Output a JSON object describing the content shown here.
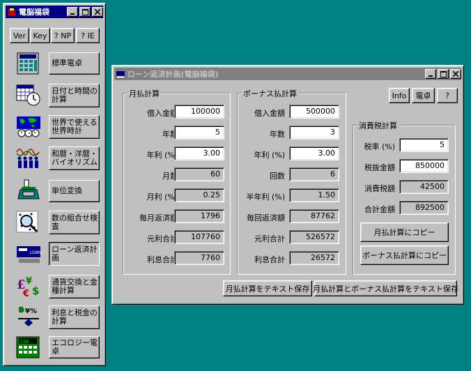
{
  "launcher": {
    "title": "電脳福袋",
    "top_buttons": [
      "Ver",
      "Key",
      "? NP",
      "? IE"
    ],
    "items": [
      {
        "label": "標準電卓",
        "icon": "calculator-icon"
      },
      {
        "label": "日付と時間の計算",
        "icon": "calendar-clock-icon"
      },
      {
        "label": "世界で使える世界時計",
        "icon": "world-clock-icon"
      },
      {
        "label": "和暦・洋暦・バイオリズム",
        "icon": "biorhythm-icon"
      },
      {
        "label": "単位変換",
        "icon": "scale-icon"
      },
      {
        "label": "数の組合せ検査",
        "icon": "magnifier-icon"
      },
      {
        "label": "ローン返済計画",
        "icon": "loan-icon"
      },
      {
        "label": "通貨交換と金種計算",
        "icon": "currency-icon"
      },
      {
        "label": "利息と税金の計算",
        "icon": "interest-tax-icon"
      },
      {
        "label": "エコロジー電卓",
        "icon": "eco-calculator-icon"
      }
    ]
  },
  "loan": {
    "title": "ローン返済計画(電脳福袋)",
    "buttons": {
      "info": "Info",
      "calc": "電卓",
      "help": "?"
    },
    "monthly": {
      "title": "月払計算",
      "rows": [
        {
          "label": "借入金額",
          "value": "100000",
          "editable": true
        },
        {
          "label": "年数",
          "value": "5",
          "editable": true
        },
        {
          "label": "年利 (%)",
          "value": "3.00",
          "editable": true
        },
        {
          "label": "月数",
          "value": "60",
          "editable": false
        },
        {
          "label": "月利 (%)",
          "value": "0.25",
          "editable": false
        },
        {
          "label": "毎月返済額",
          "value": "1796",
          "editable": false
        },
        {
          "label": "元利合計",
          "value": "107760",
          "editable": false
        },
        {
          "label": "利息合計",
          "value": "7760",
          "editable": false
        }
      ]
    },
    "bonus": {
      "title": "ボーナス払計算",
      "rows": [
        {
          "label": "借入金額",
          "value": "500000",
          "editable": true
        },
        {
          "label": "年数",
          "value": "3",
          "editable": true
        },
        {
          "label": "年利 (%)",
          "value": "3.00",
          "editable": true
        },
        {
          "label": "回数",
          "value": "6",
          "editable": false
        },
        {
          "label": "半年利 (%)",
          "value": "1.50",
          "editable": false
        },
        {
          "label": "毎回返済額",
          "value": "87762",
          "editable": false
        },
        {
          "label": "元利合計",
          "value": "526572",
          "editable": false
        },
        {
          "label": "利息合計",
          "value": "26572",
          "editable": false
        }
      ]
    },
    "tax": {
      "title": "消費税計算",
      "rows": [
        {
          "label": "税率 (%)",
          "value": "5",
          "editable": true
        },
        {
          "label": "税抜金額",
          "value": "850000",
          "editable": true
        },
        {
          "label": "消費税額",
          "value": "42500",
          "editable": false
        },
        {
          "label": "合計金額",
          "value": "892500",
          "editable": false
        }
      ],
      "copy_monthly": "月払計算にコピー",
      "copy_bonus": "ボーナス払計算にコピー"
    },
    "save_monthly": "月払計算をテキスト保存",
    "save_both": "月払計算とボーナス払計算をテキスト保存"
  }
}
